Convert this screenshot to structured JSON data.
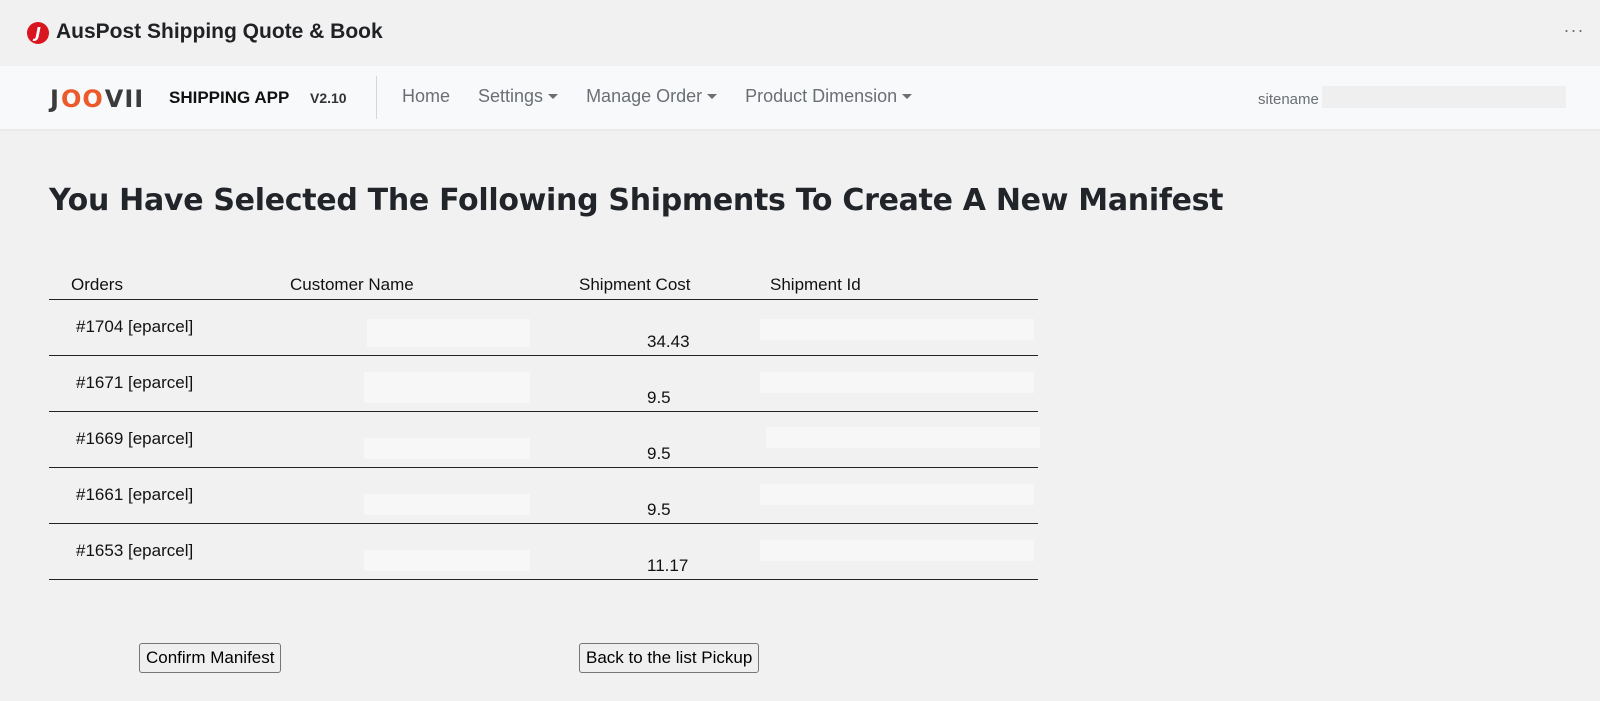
{
  "app": {
    "title": "AusPost Shipping Quote & Book",
    "logo_letter": "J",
    "more_menu": "···"
  },
  "navbar": {
    "brand": {
      "j": "J",
      "oo": "OO",
      "vii": "VII"
    },
    "app_name": "SHIPPING APP",
    "version": "V2.10",
    "items": [
      {
        "label": "Home",
        "dropdown": false
      },
      {
        "label": "Settings",
        "dropdown": true
      },
      {
        "label": "Manage Order",
        "dropdown": true
      },
      {
        "label": "Product Dimension",
        "dropdown": true
      }
    ],
    "sitename_label": "sitename",
    "sitename_value": ""
  },
  "page": {
    "title": "You Have Selected The Following Shipments To Create A New Manifest"
  },
  "table": {
    "headers": {
      "orders": "Orders",
      "customer": "Customer Name",
      "cost": "Shipment Cost",
      "shipment_id": "Shipment Id"
    },
    "rows": [
      {
        "order": "#1704 [eparcel]",
        "customer": "",
        "cost": "34.43",
        "shipment_id": ""
      },
      {
        "order": "#1671 [eparcel]",
        "customer": "",
        "cost": "9.5",
        "shipment_id": ""
      },
      {
        "order": "#1669 [eparcel]",
        "customer": "",
        "cost": "9.5",
        "shipment_id": ""
      },
      {
        "order": "#1661 [eparcel]",
        "customer": "",
        "cost": "9.5",
        "shipment_id": ""
      },
      {
        "order": "#1653 [eparcel]",
        "customer": "",
        "cost": "11.17",
        "shipment_id": ""
      }
    ]
  },
  "buttons": {
    "confirm": "Confirm Manifest",
    "back": "Back to the list Pickup"
  }
}
